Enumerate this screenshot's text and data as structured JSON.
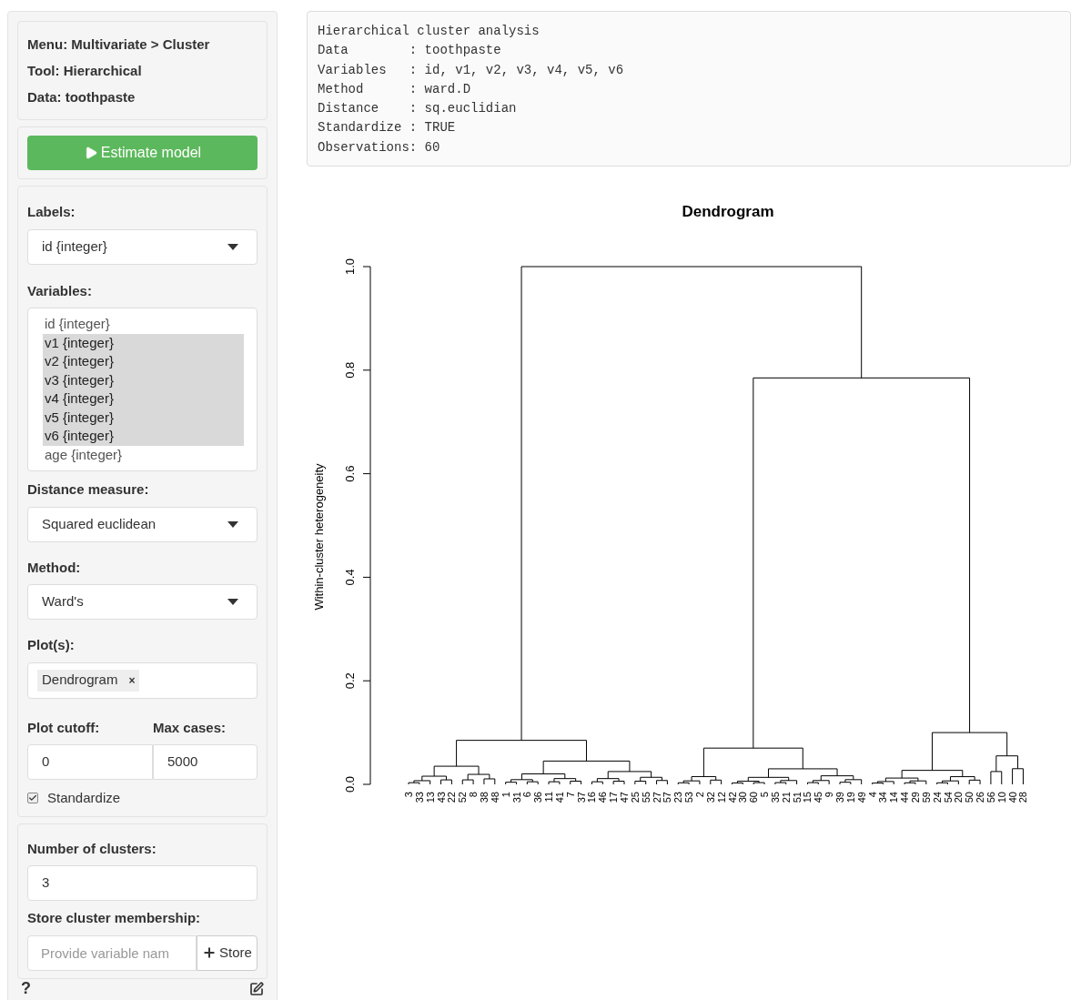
{
  "info": [
    "Menu: Multivariate > Cluster",
    "Tool: Hierarchical",
    "Data: toothpaste"
  ],
  "estimate_button": "Estimate model",
  "labels": {
    "label": "Labels:",
    "value": "id {integer}"
  },
  "variables": {
    "label": "Variables:",
    "items": [
      {
        "text": "id {integer}",
        "selected": false
      },
      {
        "text": "v1 {integer}",
        "selected": true
      },
      {
        "text": "v2 {integer}",
        "selected": true
      },
      {
        "text": "v3 {integer}",
        "selected": true
      },
      {
        "text": "v4 {integer}",
        "selected": true
      },
      {
        "text": "v5 {integer}",
        "selected": true
      },
      {
        "text": "v6 {integer}",
        "selected": true
      },
      {
        "text": "age {integer}",
        "selected": false
      }
    ]
  },
  "distance": {
    "label": "Distance measure:",
    "value": "Squared euclidean"
  },
  "method": {
    "label": "Method:",
    "value": "Ward's"
  },
  "plots": {
    "label": "Plot(s):",
    "tags": [
      "Dendrogram"
    ],
    "remove": "×"
  },
  "plot_cutoff": {
    "label": "Plot cutoff:",
    "value": "0"
  },
  "max_cases": {
    "label": "Max cases:",
    "value": "5000"
  },
  "standardize": {
    "label": "Standardize",
    "checked": true
  },
  "clusters": {
    "label": "Number of clusters:",
    "value": "3"
  },
  "store": {
    "label": "Store cluster membership:",
    "placeholder": "Provide variable nam",
    "button": "Store"
  },
  "help": "?",
  "output": [
    "Hierarchical cluster analysis",
    "Data        : toothpaste",
    "Variables   : id, v1, v2, v3, v4, v5, v6",
    "Method      : ward.D",
    "Distance    : sq.euclidian",
    "Standardize : TRUE",
    "Observations: 60"
  ],
  "dendrogram": {
    "title": "Dendrogram",
    "ylabel": "Within-cluster heterogeneity",
    "yticks": [
      "0.0",
      "0.2",
      "0.4",
      "0.6",
      "0.8",
      "1.0"
    ],
    "leaves": [
      "3",
      "33",
      "13",
      "43",
      "22",
      "52",
      "8",
      "38",
      "48",
      "1",
      "31",
      "6",
      "36",
      "11",
      "41",
      "7",
      "37",
      "16",
      "46",
      "17",
      "47",
      "25",
      "55",
      "27",
      "57",
      "23",
      "53",
      "2",
      "32",
      "12",
      "42",
      "30",
      "60",
      "5",
      "35",
      "21",
      "51",
      "15",
      "45",
      "9",
      "39",
      "19",
      "49",
      "4",
      "34",
      "14",
      "44",
      "29",
      "59",
      "24",
      "54",
      "20",
      "50",
      "26",
      "56",
      "10",
      "40",
      "28"
    ]
  }
}
